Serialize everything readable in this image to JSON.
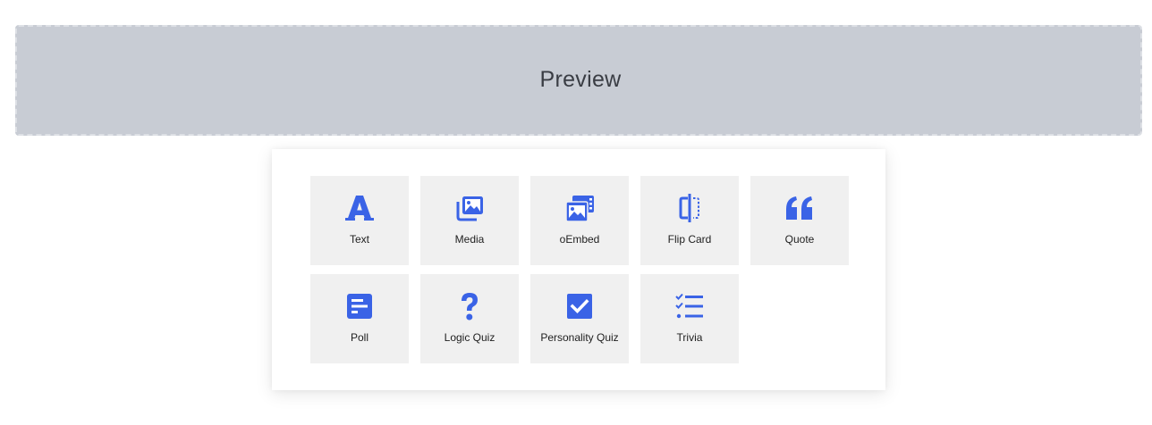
{
  "preview": {
    "label": "Preview"
  },
  "accent_color": "#3a63e6",
  "blocks": [
    {
      "label": "Text",
      "icon": "text-icon"
    },
    {
      "label": "Media",
      "icon": "media-icon"
    },
    {
      "label": "oEmbed",
      "icon": "oembed-icon"
    },
    {
      "label": "Flip Card",
      "icon": "flip-card-icon"
    },
    {
      "label": "Quote",
      "icon": "quote-icon"
    },
    {
      "label": "Poll",
      "icon": "poll-icon"
    },
    {
      "label": "Logic Quiz",
      "icon": "question-mark-icon"
    },
    {
      "label": "Personality Quiz",
      "icon": "checkbox-icon"
    },
    {
      "label": "Trivia",
      "icon": "checklist-icon"
    }
  ]
}
